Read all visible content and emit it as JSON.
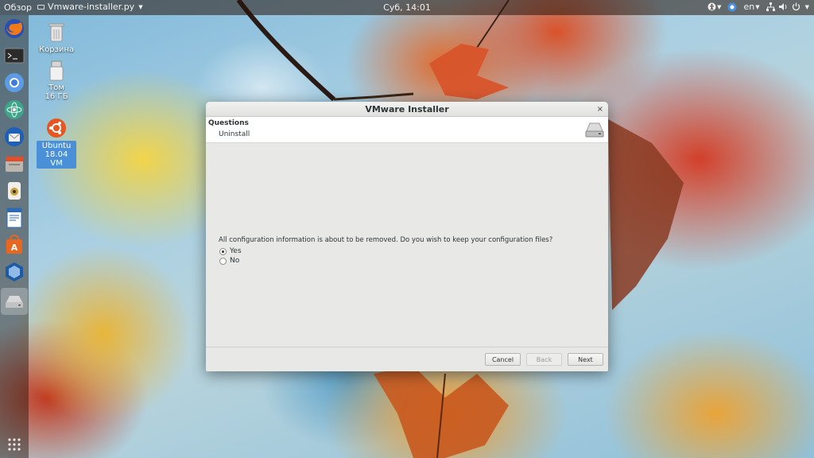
{
  "topbar": {
    "activities": "Обзор",
    "app_name": "Vmware-installer.py",
    "clock": "Суб, 14:01",
    "language": "en"
  },
  "desktop": {
    "trash_label": "Корзина",
    "volume_label": "Том 16 ГБ",
    "vm_label_line1": "Ubuntu",
    "vm_label_line2": "18.04 VM"
  },
  "dialog": {
    "title": "VMware Installer",
    "close": "×",
    "header_title": "Questions",
    "header_subtitle": "Uninstall",
    "question": "All configuration information is about to be removed. Do you wish to keep your configuration files?",
    "options": [
      {
        "label": "Yes",
        "selected": true
      },
      {
        "label": "No",
        "selected": false
      }
    ],
    "buttons": {
      "cancel": "Cancel",
      "back": "Back",
      "next": "Next"
    }
  },
  "colors": {
    "dialog_bg": "#e8e8e7",
    "selection": "#4a90d9",
    "ubuntu_orange": "#e95420"
  },
  "dock_icons": [
    "firefox-icon",
    "terminal-icon",
    "chromium-icon",
    "atom-icon",
    "thunderbird-icon",
    "files-icon",
    "rhythmbox-icon",
    "libreoffice-writer-icon",
    "software-center-icon",
    "virtualbox-icon",
    "vmware-installer-icon",
    "show-apps-icon"
  ]
}
